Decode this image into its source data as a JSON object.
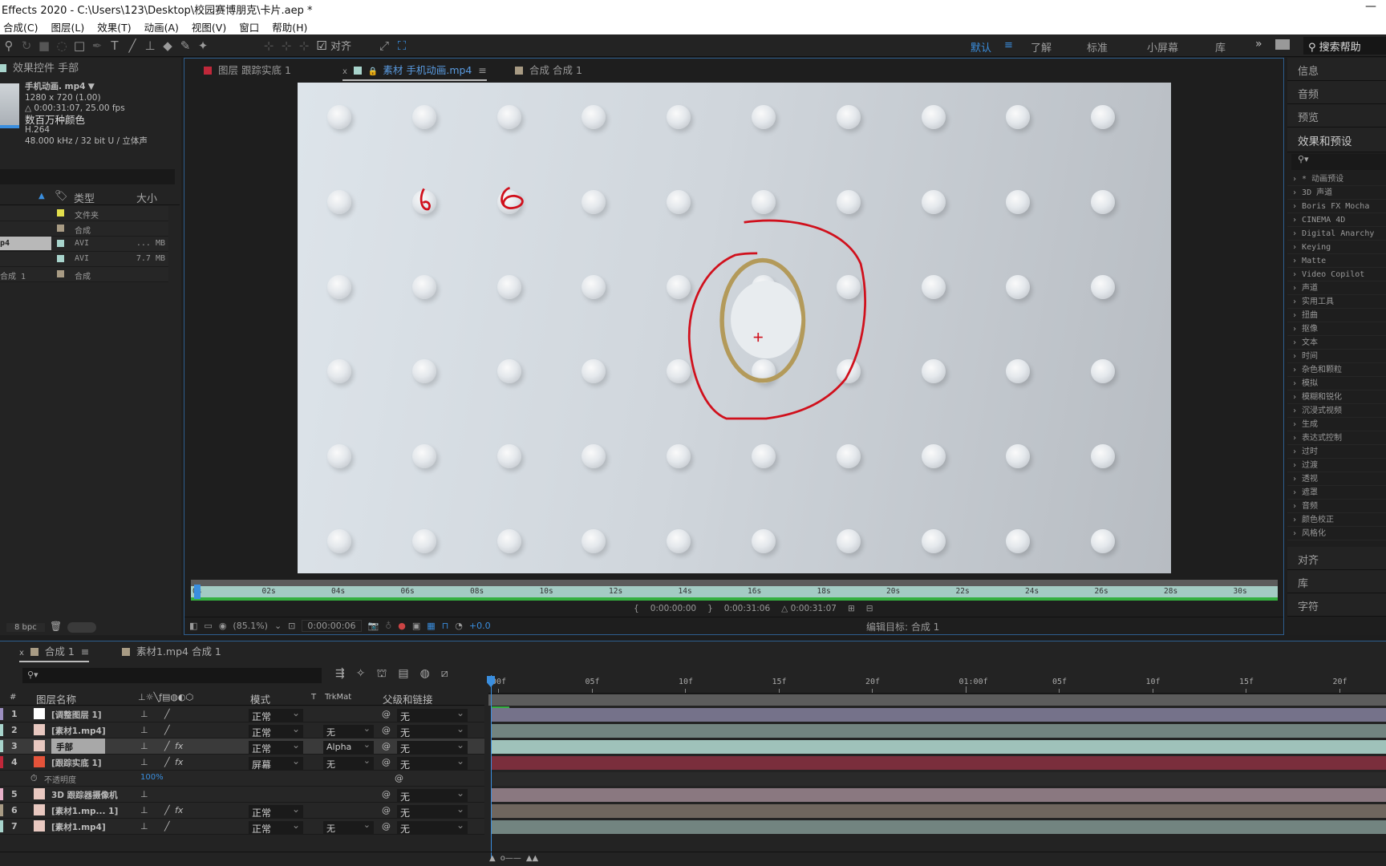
{
  "title": "Effects 2020 - C:\\Users\\123\\Desktop\\校园赛博朋克\\卡片.aep *",
  "menu": [
    "合成(C)",
    "图层(L)",
    "效果(T)",
    "动画(A)",
    "视图(V)",
    "窗口",
    "帮助(H)"
  ],
  "toolbar": {
    "snap_label": "对齐",
    "snap_checked": true,
    "workspaces": [
      "默认",
      "了解",
      "标准",
      "小屏幕",
      "库"
    ],
    "active_workspace": "默认",
    "help_placeholder": "搜索帮助"
  },
  "left": {
    "panel_title": "效果控件 手部",
    "file": {
      "name": "手机动画. mp4",
      "res": "1280 x 720 (1.00)",
      "duration": "△ 0:00:31:07, 25.00 fps",
      "colors": "数百万种颜色",
      "codec": "H.264",
      "audio": "48.000 kHz / 32 bit U / 立体声"
    },
    "headers": {
      "type": "类型",
      "size": "大小"
    },
    "items": [
      {
        "name": "",
        "type": "文件夹",
        "size": "",
        "color": "#e3df4c"
      },
      {
        "name": "",
        "type": "合成",
        "size": "",
        "color": "#a89b84"
      },
      {
        "name": "p4",
        "type": "AVI",
        "size": "... MB",
        "color": "#a8d4cc",
        "selected": true
      },
      {
        "name": "",
        "type": "AVI",
        "size": "7.7 MB",
        "color": "#a8d4cc"
      },
      {
        "name": "合成 1",
        "type": "合成",
        "size": "",
        "color": "#a89b84"
      }
    ],
    "bpc": "8 bpc"
  },
  "viewer": {
    "tabs": [
      {
        "label": "图层 跟踪实底 1",
        "color": "#c0283a"
      },
      {
        "label": "素材 手机动画.mp4",
        "color": "#a8d4cc",
        "active": true
      },
      {
        "label": "合成 合成 1",
        "color": "#a89b84"
      }
    ],
    "ruler": [
      "0s",
      "02s",
      "04s",
      "06s",
      "08s",
      "10s",
      "12s",
      "14s",
      "16s",
      "18s",
      "20s",
      "22s",
      "24s",
      "26s",
      "28s",
      "30s"
    ],
    "in_point": "0:00:00:00",
    "out_point": "0:00:31:06",
    "duration": "△ 0:00:31:07",
    "zoom": "(85.1%)",
    "current_time": "0:00:00:06",
    "exposure": "+0.0",
    "edit_target": "编辑目标: 合成 1"
  },
  "right": {
    "tabs": [
      "信息",
      "音频",
      "预览"
    ],
    "effects_title": "效果和预设",
    "effects": [
      "* 动画预设",
      "3D 声道",
      "Boris FX Mocha",
      "CINEMA 4D",
      "Digital Anarchy",
      "Keying",
      "Matte",
      "Video Copilot",
      "声道",
      "实用工具",
      "扭曲",
      "抠像",
      "文本",
      "时间",
      "杂色和颗粒",
      "模拟",
      "模糊和锐化",
      "沉浸式视频",
      "生成",
      "表达式控制",
      "过时",
      "过渡",
      "透视",
      "遮罩",
      "音频",
      "颜色校正",
      "风格化"
    ],
    "bottom_tabs": [
      "对齐",
      "库",
      "字符"
    ]
  },
  "timeline": {
    "tabs": [
      {
        "label": "合成 1",
        "color": "#a89b84",
        "active": true
      },
      {
        "label": "素材1.mp4 合成 1",
        "color": "#a89b84"
      }
    ],
    "headers": {
      "num": "#",
      "name": "图层名称",
      "mode": "模式",
      "t": "T",
      "trkmat": "TrkMat",
      "parent": "父级和链接"
    },
    "ruler": [
      "00f",
      "05f",
      "10f",
      "15f",
      "20f",
      "01:00f",
      "05f",
      "10f",
      "15f",
      "20f"
    ],
    "layers": [
      {
        "num": "1",
        "name": "[调整图层 1]",
        "label": "#9c8fc0",
        "mode": "正常",
        "trkmat": "",
        "parent": "无",
        "bar": "#75728a",
        "fx": false
      },
      {
        "num": "2",
        "name": "[素材1.mp4]",
        "label": "#a8d4cc",
        "mode": "正常",
        "trkmat": "无",
        "parent": "无",
        "bar": "#728480",
        "fx": false
      },
      {
        "num": "3",
        "name": "手部",
        "label": "#a8d4cc",
        "mode": "正常",
        "trkmat": "Alpha",
        "parent": "无",
        "bar": "#9fc2ba",
        "fx": true,
        "selected": true
      },
      {
        "num": "4",
        "name": "[跟踪实底 1]",
        "label": "#c0283a",
        "mode": "屏幕",
        "trkmat": "无",
        "parent": "无",
        "bar": "#7a2e3c",
        "fx": true
      },
      {
        "num": "",
        "name": "不透明度",
        "value": "100%",
        "property": true
      },
      {
        "num": "5",
        "name": "3D 跟踪器摄像机",
        "label": "#e6b0c8",
        "mode": "",
        "trkmat": "",
        "parent": "无",
        "bar": "#8a7880",
        "fx": false
      },
      {
        "num": "6",
        "name": "[素材1.mp... 1]",
        "label": "#a89b84",
        "mode": "正常",
        "trkmat": "",
        "parent": "无",
        "bar": "#6f665e",
        "fx": true
      },
      {
        "num": "7",
        "name": "[素材1.mp4]",
        "label": "#a8d4cc",
        "mode": "正常",
        "trkmat": "无",
        "parent": "无",
        "bar": "#728480",
        "fx": false
      }
    ]
  },
  "colors": {
    "accent": "#2d8ceb",
    "work_area": "#a3cbc3",
    "cache": "#34b040",
    "annotation": "#d0101c"
  }
}
